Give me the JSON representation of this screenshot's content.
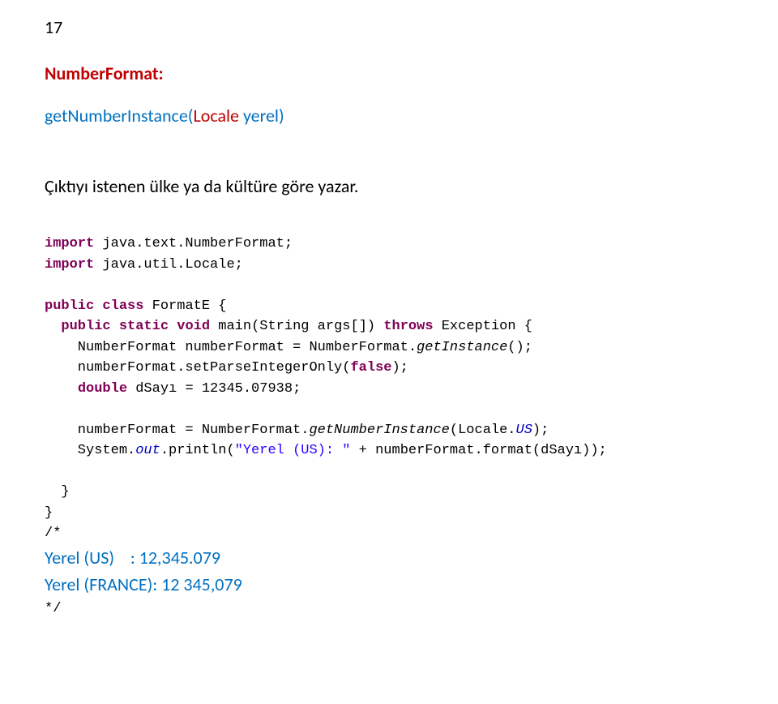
{
  "pageNumber": "17",
  "sectionTitle": "NumberFormat:",
  "signature": {
    "before": "getNumberInstance(",
    "paramType": "Locale",
    "paramName": " yerel",
    "after": ")"
  },
  "description": "Çıktıyı istenen ülke ya da kültüre göre yazar.",
  "code": {
    "importKw": "import",
    "import1": " java.text.NumberFormat;",
    "import2": " java.util.Locale;",
    "publicKw": "public",
    "classKw": "class",
    "className": " FormatE {",
    "staticKw": "static",
    "voidKw": "void",
    "mainSig": " main(String args[]) ",
    "throwsKw": "throws",
    "exception": " Exception {",
    "line1a": "    NumberFormat numberFormat = NumberFormat.",
    "line1b": "getInstance",
    "line1c": "();",
    "line2a": "    numberFormat.setParseIntegerOnly(",
    "falseKw": "false",
    "line2b": ");",
    "doubleKw": "double",
    "line3a": "    ",
    "line3b": " dSayı = 12345.07938;",
    "line4a": "    numberFormat = NumberFormat.",
    "line4b": "getNumberInstance",
    "line4c": "(Locale.",
    "line4d": "US",
    "line4e": ");",
    "line5a": "    System.",
    "line5b": "out",
    "line5c": ".println(",
    "line5str": "\"Yerel (US): \"",
    "line5d": " + numberFormat.format(dSayı));",
    "closeBrace1": "  }",
    "closeBrace2": "}",
    "commentStart": "/*",
    "commentEnd": "*/"
  },
  "output": {
    "line1": "Yerel (US)    : 12,345.079",
    "line2": "Yerel (FRANCE): 12 345,079"
  }
}
